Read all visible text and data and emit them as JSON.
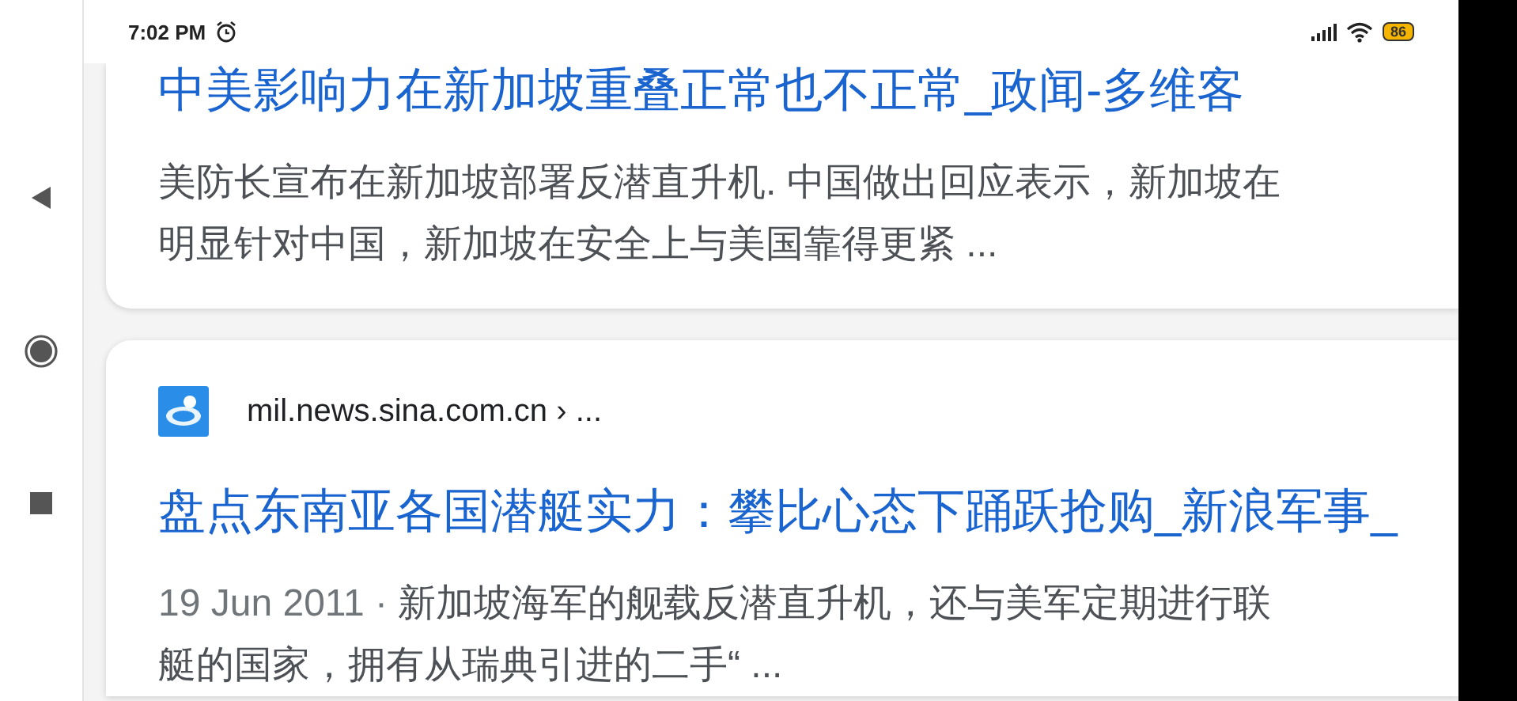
{
  "status_bar": {
    "time": "7:02 PM",
    "battery": "86"
  },
  "nav_bar": {
    "buttons": [
      {
        "kind": "back"
      },
      {
        "kind": "home"
      },
      {
        "kind": "recents"
      }
    ]
  },
  "results": [
    {
      "title": "中美影响力在新加坡重叠正常也不正常_政闻-多维客",
      "snippet_lines": [
        "美防长宣布在新加坡部署反潜直升机. 中国做出回应表示，新加坡在",
        "明显针对中国，新加坡在安全上与美国靠得更紧 ..."
      ]
    },
    {
      "source": "mil.news.sina.com.cn › ...",
      "title": "盘点东南亚各国潜艇实力：攀比心态下踊跃抢购_新浪军事_",
      "date": "19 Jun 2011 ·",
      "snippet_lines": [
        "新加坡海军的舰载反潜直升机，还与美军定期进行联",
        "艇的国家，拥有从瑞典引进的二手“ ..."
      ]
    }
  ]
}
